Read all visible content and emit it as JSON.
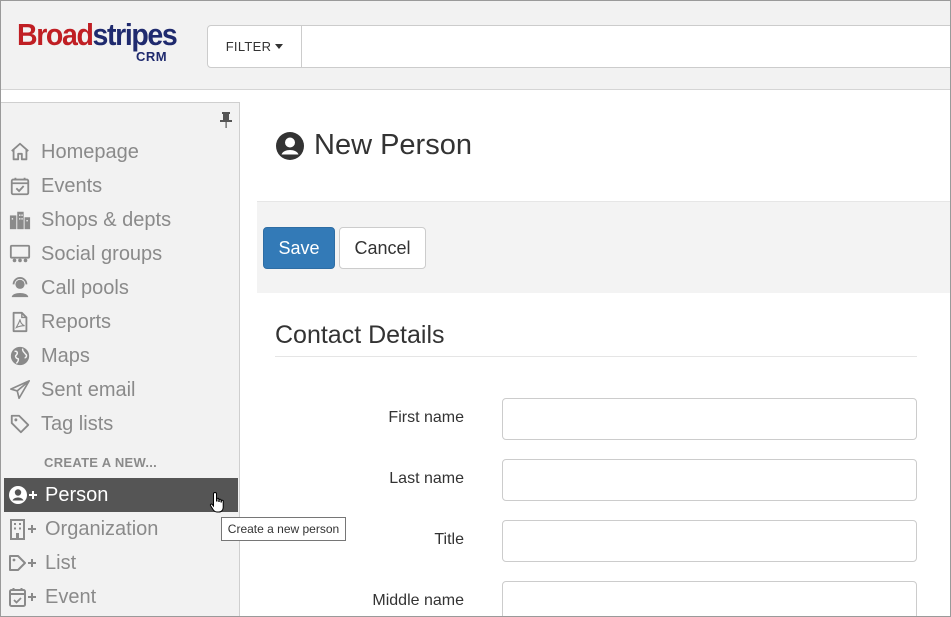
{
  "logo": {
    "brand_part1": "Broad",
    "brand_part2": "stripes",
    "sub": "CRM"
  },
  "search": {
    "filter_label": "FILTER",
    "placeholder": "",
    "value": ""
  },
  "sidebar": {
    "items": [
      {
        "label": "Homepage",
        "icon": "home-icon"
      },
      {
        "label": "Events",
        "icon": "calendar-check-icon"
      },
      {
        "label": "Shops & depts",
        "icon": "buildings-icon"
      },
      {
        "label": "Social groups",
        "icon": "social-group-icon"
      },
      {
        "label": "Call pools",
        "icon": "headset-person-icon"
      },
      {
        "label": "Reports",
        "icon": "pdf-document-icon"
      },
      {
        "label": "Maps",
        "icon": "globe-icon"
      },
      {
        "label": "Sent email",
        "icon": "paper-plane-icon"
      },
      {
        "label": "Tag lists",
        "icon": "tag-icon"
      }
    ],
    "create_heading": "CREATE A NEW...",
    "create_items": [
      {
        "label": "Person",
        "icon": "person-plus-icon",
        "active": true
      },
      {
        "label": "Organization",
        "icon": "building-plus-icon",
        "active": false
      },
      {
        "label": "List",
        "icon": "tag-plus-icon",
        "active": false
      },
      {
        "label": "Event",
        "icon": "calendar-plus-icon",
        "active": false
      }
    ],
    "tooltip": "Create a new person"
  },
  "main": {
    "title": "New Person",
    "save_label": "Save",
    "cancel_label": "Cancel",
    "section_title": "Contact Details",
    "fields": [
      {
        "label": "First name",
        "value": ""
      },
      {
        "label": "Last name",
        "value": ""
      },
      {
        "label": "Title",
        "value": ""
      },
      {
        "label": "Middle name",
        "value": ""
      }
    ]
  },
  "colors": {
    "brand_red": "#c01f24",
    "brand_navy": "#1f2a6e",
    "primary_button": "#337ab7",
    "active_nav": "#555555",
    "muted_text": "#8a8a8a"
  }
}
